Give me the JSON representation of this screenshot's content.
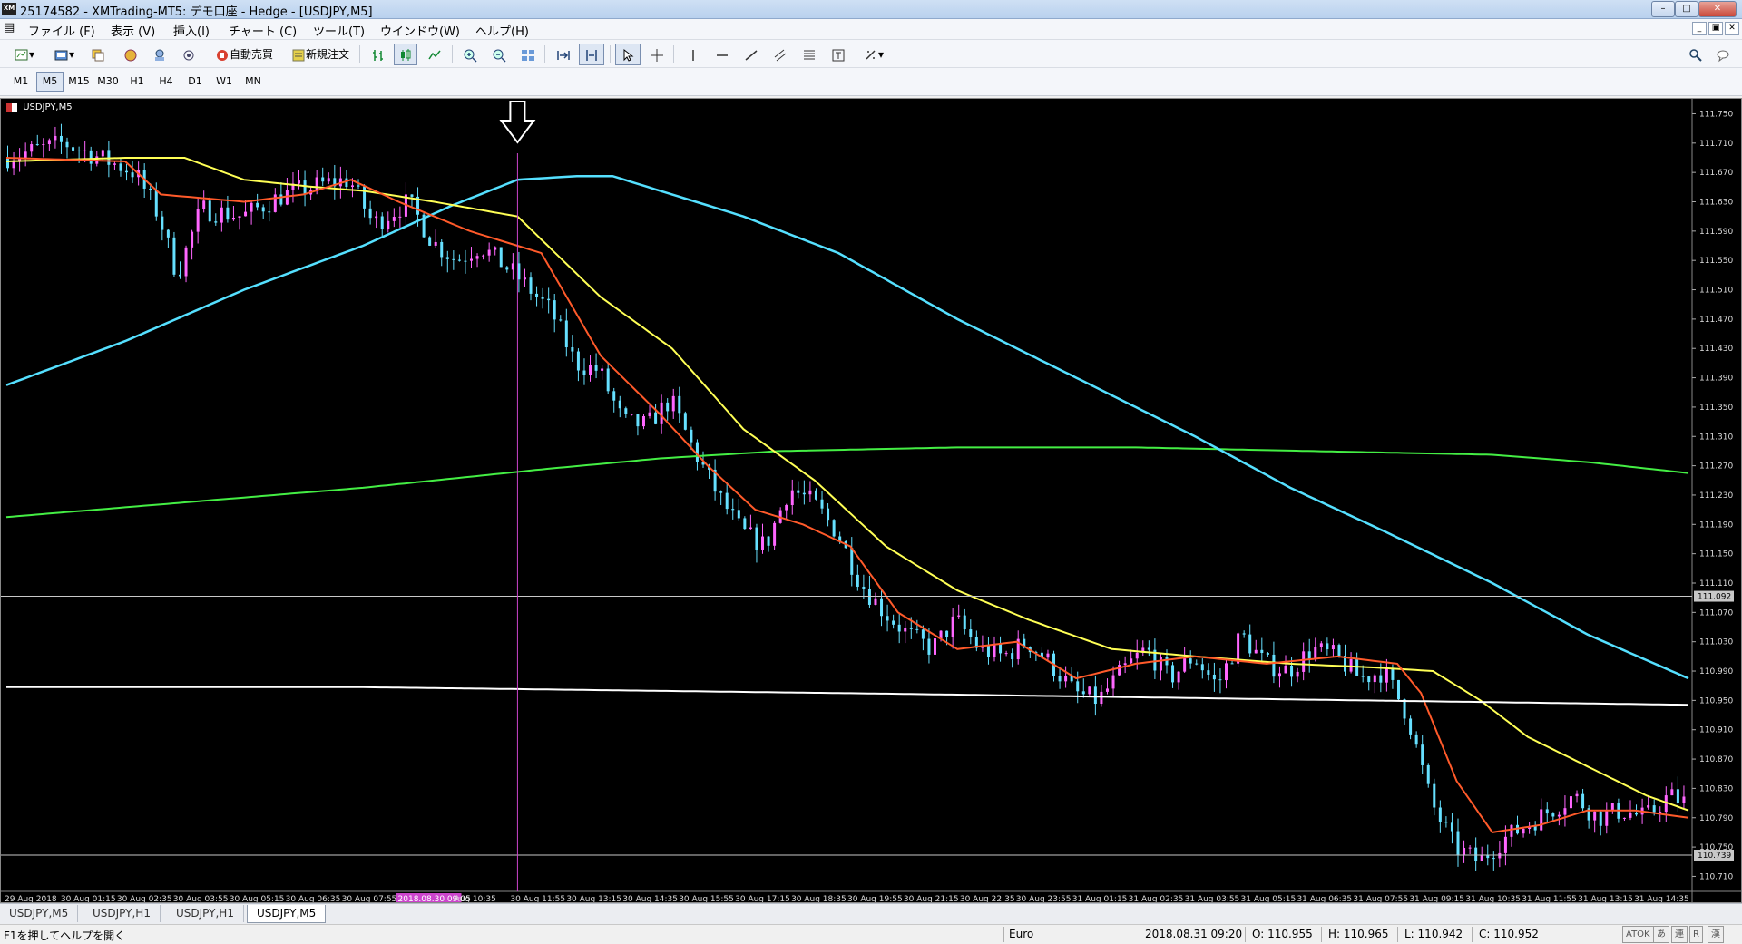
{
  "window": {
    "title": "25174582 - XMTrading-MT5: デモ口座 - Hedge - [USDJPY,M5]",
    "app_icon": "XM"
  },
  "menu": [
    "ファイル (F)",
    "表示 (V)",
    "挿入(I)",
    "チャート (C)",
    "ツール(T)",
    "ウインドウ(W)",
    "ヘルプ(H)"
  ],
  "toolbar": {
    "auto_trade_label": "自動売買",
    "new_order_label": "新規注文"
  },
  "timeframes": [
    "M1",
    "M5",
    "M15",
    "M30",
    "H1",
    "H4",
    "D1",
    "W1",
    "MN"
  ],
  "active_timeframe": "M5",
  "chart": {
    "symbol_label": "USDJPY,M5",
    "price_scale": [
      "111.750",
      "111.710",
      "111.670",
      "111.630",
      "111.590",
      "111.550",
      "111.510",
      "111.470",
      "111.430",
      "111.390",
      "111.350",
      "111.310",
      "111.270",
      "111.230",
      "111.190",
      "111.150",
      "111.110",
      "111.070",
      "111.030",
      "110.990",
      "110.950",
      "110.910",
      "110.870",
      "110.830",
      "110.790",
      "110.750",
      "110.710"
    ],
    "price_max": 111.758,
    "price_min": 110.692,
    "hline_price_1": "111.092",
    "hline_price_2": "110.739",
    "time_labels": [
      "29 Aug 2018",
      "30 Aug 01:15",
      "30 Aug 02:35",
      "30 Aug 03:55",
      "30 Aug 05:15",
      "30 Aug 06:35",
      "30 Aug 07:55",
      "2018.08.30 09:05",
      "Aug 10:35",
      "30 Aug 11:55",
      "30 Aug 13:15",
      "30 Aug 14:35",
      "30 Aug 15:55",
      "30 Aug 17:15",
      "30 Aug 18:35",
      "30 Aug 19:55",
      "30 Aug 21:15",
      "30 Aug 22:35",
      "30 Aug 23:55",
      "31 Aug 01:15",
      "31 Aug 02:35",
      "31 Aug 03:55",
      "31 Aug 05:15",
      "31 Aug 06:35",
      "31 Aug 07:55",
      "31 Aug 09:15",
      "31 Aug 10:35",
      "31 Aug 11:55",
      "31 Aug 13:15",
      "31 Aug 14:35"
    ],
    "crosshair_time_label": "2018.08.30 09:05",
    "colors": {
      "background": "#000000",
      "bull_candle": "#ff66ff",
      "bear_candle": "#66e0ff",
      "ma_fast": "#ff5a2a",
      "ma_mid": "#ffff55",
      "ma_slow": "#55e0ff",
      "ma_long": "#44ee44",
      "trendline": "#ffffff",
      "crosshair": "#cc44cc"
    },
    "price_path": [
      [
        0,
        111.69
      ],
      [
        10,
        111.71
      ],
      [
        16,
        111.69
      ],
      [
        22,
        111.67
      ],
      [
        26,
        111.61
      ],
      [
        29,
        111.53
      ],
      [
        33,
        111.62
      ],
      [
        40,
        111.61
      ],
      [
        47,
        111.64
      ],
      [
        54,
        111.655
      ],
      [
        58,
        111.66
      ],
      [
        62,
        111.6
      ],
      [
        68,
        111.63
      ],
      [
        72,
        111.575
      ],
      [
        76,
        111.55
      ],
      [
        80,
        111.57
      ],
      [
        86,
        111.53
      ],
      [
        92,
        111.48
      ],
      [
        96,
        111.41
      ],
      [
        100,
        111.4
      ],
      [
        104,
        111.33
      ],
      [
        108,
        111.325
      ],
      [
        112,
        111.36
      ],
      [
        116,
        111.29
      ],
      [
        120,
        111.23
      ],
      [
        124,
        111.18
      ],
      [
        128,
        111.16
      ],
      [
        132,
        111.24
      ],
      [
        136,
        111.22
      ],
      [
        140,
        111.18
      ],
      [
        144,
        111.11
      ],
      [
        148,
        111.07
      ],
      [
        152,
        111.04
      ],
      [
        156,
        111.02
      ],
      [
        160,
        111.06
      ],
      [
        164,
        111.02
      ],
      [
        168,
        111.01
      ],
      [
        172,
        111.03
      ],
      [
        176,
        111.0
      ],
      [
        180,
        110.96
      ],
      [
        184,
        110.95
      ],
      [
        188,
        110.99
      ],
      [
        192,
        111.02
      ],
      [
        196,
        110.98
      ],
      [
        200,
        111.01
      ],
      [
        204,
        110.97
      ],
      [
        208,
        111.04
      ],
      [
        212,
        111.0
      ],
      [
        216,
        110.99
      ],
      [
        220,
        111.02
      ],
      [
        224,
        111.01
      ],
      [
        228,
        110.98
      ],
      [
        232,
        110.99
      ],
      [
        236,
        110.93
      ],
      [
        240,
        110.81
      ],
      [
        244,
        110.75
      ],
      [
        248,
        110.73
      ],
      [
        252,
        110.76
      ],
      [
        256,
        110.78
      ],
      [
        260,
        110.8
      ],
      [
        264,
        110.82
      ],
      [
        268,
        110.79
      ],
      [
        272,
        110.8
      ],
      [
        276,
        110.79
      ],
      [
        280,
        110.82
      ],
      [
        283,
        110.81
      ]
    ],
    "ma_fast": [
      [
        0,
        111.69
      ],
      [
        20,
        111.685
      ],
      [
        26,
        111.64
      ],
      [
        40,
        111.63
      ],
      [
        50,
        111.64
      ],
      [
        58,
        111.66
      ],
      [
        66,
        111.63
      ],
      [
        78,
        111.59
      ],
      [
        90,
        111.56
      ],
      [
        100,
        111.42
      ],
      [
        110,
        111.34
      ],
      [
        118,
        111.27
      ],
      [
        126,
        111.21
      ],
      [
        134,
        111.19
      ],
      [
        142,
        111.16
      ],
      [
        150,
        111.07
      ],
      [
        160,
        111.02
      ],
      [
        170,
        111.03
      ],
      [
        180,
        110.98
      ],
      [
        190,
        111.0
      ],
      [
        200,
        111.01
      ],
      [
        212,
        111.0
      ],
      [
        224,
        111.01
      ],
      [
        234,
        111.0
      ],
      [
        238,
        110.96
      ],
      [
        244,
        110.84
      ],
      [
        250,
        110.77
      ],
      [
        258,
        110.78
      ],
      [
        266,
        110.8
      ],
      [
        274,
        110.8
      ],
      [
        283,
        110.79
      ]
    ],
    "ma_mid": [
      [
        0,
        111.685
      ],
      [
        20,
        111.69
      ],
      [
        30,
        111.69
      ],
      [
        40,
        111.66
      ],
      [
        52,
        111.65
      ],
      [
        60,
        111.645
      ],
      [
        72,
        111.63
      ],
      [
        86,
        111.61
      ],
      [
        100,
        111.5
      ],
      [
        112,
        111.43
      ],
      [
        124,
        111.32
      ],
      [
        136,
        111.25
      ],
      [
        148,
        111.16
      ],
      [
        160,
        111.1
      ],
      [
        172,
        111.06
      ],
      [
        186,
        111.02
      ],
      [
        200,
        111.01
      ],
      [
        216,
        111.0
      ],
      [
        230,
        110.995
      ],
      [
        240,
        110.99
      ],
      [
        248,
        110.95
      ],
      [
        256,
        110.9
      ],
      [
        266,
        110.86
      ],
      [
        276,
        110.82
      ],
      [
        283,
        110.8
      ]
    ],
    "ma_slow": [
      [
        0,
        111.38
      ],
      [
        20,
        111.44
      ],
      [
        40,
        111.51
      ],
      [
        60,
        111.57
      ],
      [
        75,
        111.625
      ],
      [
        86,
        111.66
      ],
      [
        96,
        111.665
      ],
      [
        102,
        111.665
      ],
      [
        112,
        111.64
      ],
      [
        124,
        111.61
      ],
      [
        140,
        111.56
      ],
      [
        160,
        111.47
      ],
      [
        180,
        111.39
      ],
      [
        200,
        111.31
      ],
      [
        216,
        111.24
      ],
      [
        232,
        111.18
      ],
      [
        250,
        111.11
      ],
      [
        266,
        111.04
      ],
      [
        283,
        110.98
      ]
    ],
    "ma_long": [
      [
        0,
        111.2
      ],
      [
        30,
        111.22
      ],
      [
        60,
        111.24
      ],
      [
        90,
        111.265
      ],
      [
        110,
        111.28
      ],
      [
        130,
        111.29
      ],
      [
        160,
        111.295
      ],
      [
        190,
        111.295
      ],
      [
        220,
        111.29
      ],
      [
        250,
        111.285
      ],
      [
        266,
        111.275
      ],
      [
        283,
        111.26
      ]
    ],
    "trendline": [
      [
        0,
        110.968
      ],
      [
        60,
        110.968
      ],
      [
        150,
        110.959
      ],
      [
        210,
        110.952
      ],
      [
        283,
        110.944
      ]
    ]
  },
  "tabs": [
    "USDJPY,M5",
    "USDJPY,H1",
    "USDJPY,H1",
    "USDJPY,M5"
  ],
  "active_tab": 3,
  "status": {
    "help": "F1を押してヘルプを開く",
    "profile": "Euro",
    "time": "2018.08.31 09:20",
    "open": "O: 110.955",
    "high": "H: 110.965",
    "low": "L: 110.942",
    "close": "C: 110.952",
    "ime": [
      "ATOK",
      "あ",
      "連",
      "R",
      "漢"
    ]
  }
}
